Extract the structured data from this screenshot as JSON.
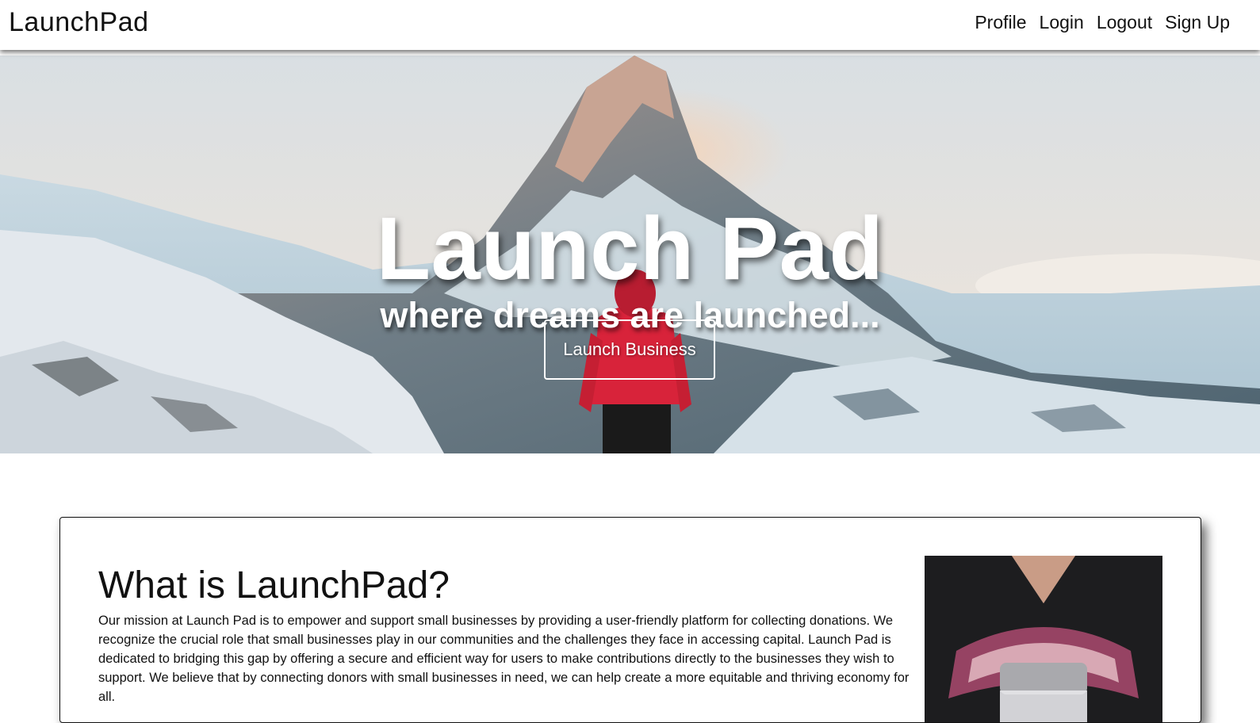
{
  "navbar": {
    "brand": "LaunchPad",
    "links": [
      {
        "label": "Profile"
      },
      {
        "label": "Login"
      },
      {
        "label": "Logout"
      },
      {
        "label": "Sign Up"
      }
    ]
  },
  "hero": {
    "title": "Launch Pad",
    "subtitle": "where dreams are launched...",
    "button_label": "Launch Business"
  },
  "about": {
    "title": "What is LaunchPad?",
    "text": "Our mission at Launch Pad is to empower and support small businesses by providing a user-friendly platform for collecting donations. We recognize the crucial role that small businesses play in our communities and the challenges they face in accessing capital. Launch Pad is dedicated to bridging this gap by offering a secure and efficient way for users to make contributions directly to the businesses they wish to support. We believe that by connecting donors with small businesses in need, we can help create a more equitable and thriving economy for all."
  },
  "colors": {
    "navbar_bg": "#ffffff",
    "text": "#111111",
    "hero_text": "#ffffff",
    "jacket_red": "#d8233a"
  },
  "icons": {
    "hero_background": "mountain-snow-landscape-image",
    "about_image": "person-holding-donation-jar-image"
  }
}
